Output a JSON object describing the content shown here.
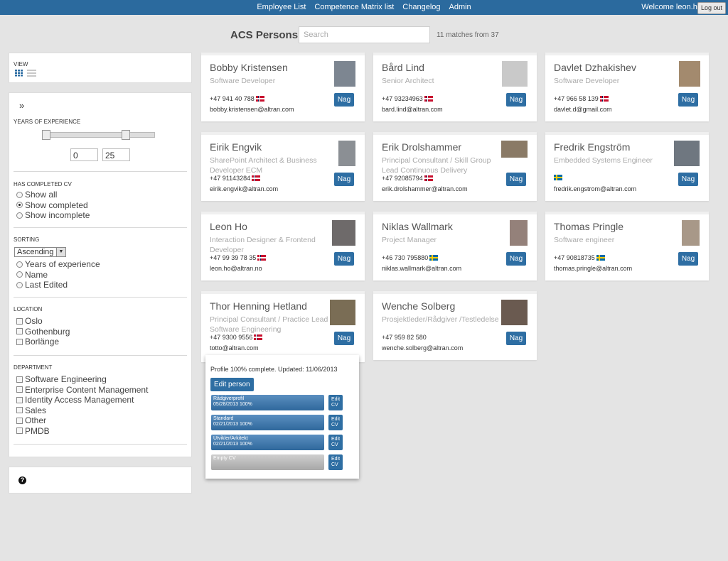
{
  "nav": {
    "items": [
      "Employee List",
      "Competence Matrix list",
      "Changelog",
      "Admin"
    ],
    "welcome": "Welcome leon.ho",
    "logout": "Log out"
  },
  "header": {
    "title": "ACS Persons",
    "search_placeholder": "Search",
    "matches": "11 matches from 37"
  },
  "sidebar": {
    "view_label": "VIEW",
    "experience": {
      "label": "YEARS OF EXPERIENCE",
      "min": "0",
      "max": "25",
      "slider_range": [
        0,
        25
      ]
    },
    "cv": {
      "label": "HAS COMPLETED CV",
      "options": [
        "Show all",
        "Show completed",
        "Show incomplete"
      ],
      "selected": "Show completed"
    },
    "sorting": {
      "label": "SORTING",
      "order": "Ascending",
      "options": [
        "Years of experience",
        "Name",
        "Last Edited"
      ]
    },
    "location": {
      "label": "LOCATION",
      "options": [
        "Oslo",
        "Gothenburg",
        "Borlänge"
      ]
    },
    "department": {
      "label": "DEPARTMENT",
      "options": [
        "Software Engineering",
        "Enterprise Content Management",
        "Identity Access Management",
        "Sales",
        "Other",
        "PMDB"
      ]
    }
  },
  "nag_label": "Nag",
  "persons": [
    {
      "name": "Bobby Kristensen",
      "title": "Software Developer",
      "phone": "+47 941 40 788",
      "flag": "no",
      "email": "bobby.kristensen@altran.com"
    },
    {
      "name": "Bård Lind",
      "title": "Senior Architect",
      "phone": "+47 93234963",
      "flag": "no",
      "email": "bard.lind@altran.com"
    },
    {
      "name": "Davlet Dzhakishev",
      "title": "Software Developer",
      "phone": "+47 966 58 139",
      "flag": "no",
      "email": "davlet.d@gmail.com"
    },
    {
      "name": "Eirik Engvik",
      "title": "SharePoint Architect & Business Developer ECM",
      "phone": "+47 91143284",
      "flag": "no",
      "email": "eirik.engvik@altran.com"
    },
    {
      "name": "Erik Drolshammer",
      "title": "Principal Consultant / Skill Group Lead Continuous Delivery",
      "phone": "+47 92085794",
      "flag": "no",
      "email": "erik.drolshammer@altran.com"
    },
    {
      "name": "Fredrik Engström",
      "title": "Embedded Systems Engineer",
      "phone": "",
      "flag": "se",
      "email": "fredrik.engstrom@altran.com"
    },
    {
      "name": "Leon Ho",
      "title": "Interaction Designer & Frontend Developer",
      "phone": "+47 99 39 78 35",
      "flag": "no",
      "email": "leon.ho@altran.no"
    },
    {
      "name": "Niklas Wallmark",
      "title": "Project Manager",
      "phone": "+46 730 795880",
      "flag": "se",
      "email": "niklas.wallmark@altran.com"
    },
    {
      "name": "Thomas Pringle",
      "title": "Software engineer",
      "phone": "+47 90818735",
      "flag": "se",
      "email": "thomas.pringle@altran.com"
    },
    {
      "name": "Thor Henning Hetland",
      "title": "Principal Consultant / Practice Lead Software Engineering",
      "phone": "+47 9300 9556",
      "flag": "no",
      "email": "totto@altran.com"
    },
    {
      "name": "Wenche Solberg",
      "title": "Prosjektleder/Rådgiver /Testledelse",
      "phone": "+47 959 82 580",
      "flag": "",
      "email": "wenche.solberg@altran.com"
    }
  ],
  "popup": {
    "status": "Profile 100% complete. Updated: 11/06/2013",
    "edit_person": "Edit person",
    "edit_cv": "Edit CV",
    "cvs": [
      {
        "name": "Rådgiverprofil",
        "meta": "05/28/2013 100%",
        "empty": false
      },
      {
        "name": "Standard",
        "meta": "02/21/2013 100%",
        "empty": false
      },
      {
        "name": "Utvikler/Arkitekt",
        "meta": "02/21/2013 100%",
        "empty": false
      },
      {
        "name": "Empty CV",
        "meta": "",
        "empty": true
      }
    ]
  },
  "colors": {
    "accent": "#2e6ea3",
    "topbar": "#2b6a9e",
    "background": "#e4e4e4"
  }
}
